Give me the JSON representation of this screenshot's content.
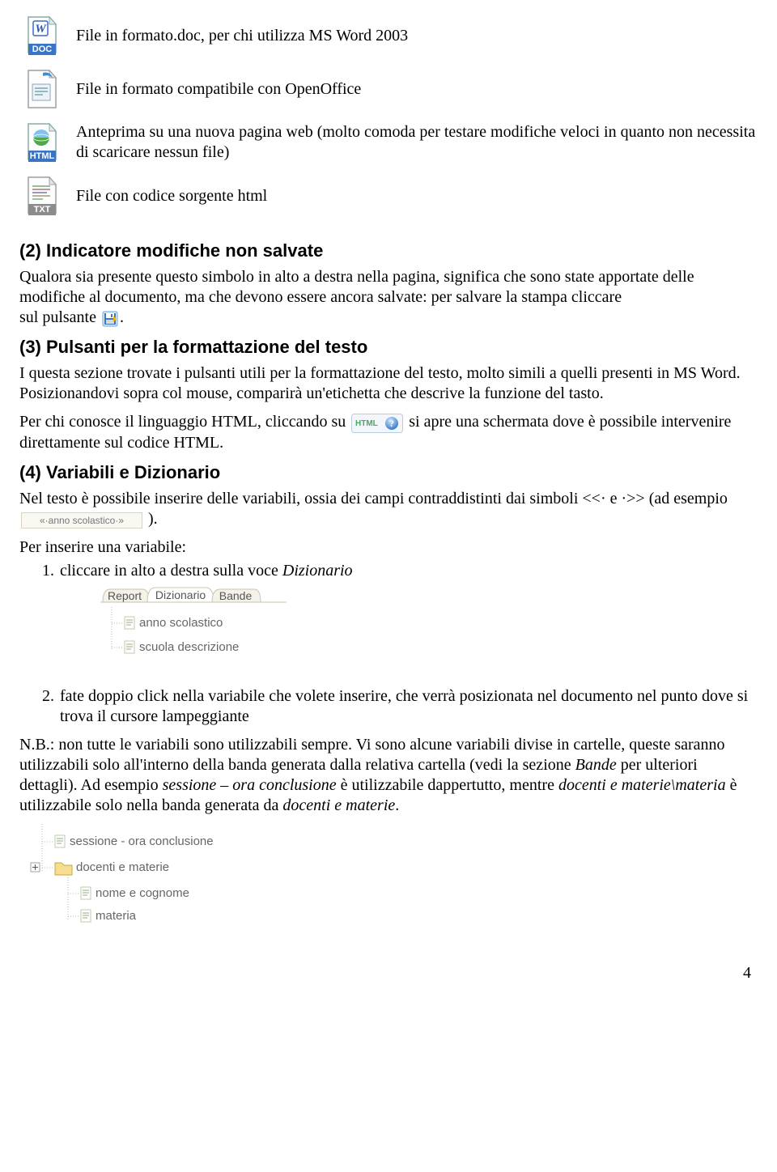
{
  "iconList": [
    {
      "type": "doc",
      "desc": "File in formato.doc, per chi utilizza MS Word 2003"
    },
    {
      "type": "oo",
      "desc": "File in formato compatibile con OpenOffice"
    },
    {
      "type": "html",
      "desc": "Anteprima su una nuova pagina web (molto comoda per testare modifiche veloci in quanto non necessita di scaricare nessun file)"
    },
    {
      "type": "txt",
      "desc": "File con codice sorgente html"
    }
  ],
  "sec2": {
    "title": "(2) Indicatore modifiche non salvate",
    "para_a": "Qualora sia presente questo simbolo in alto a destra nella pagina, significa che sono state apportate delle modifiche al documento, ma che devono essere ancora salvate: per salvare la stampa cliccare",
    "para_b": "sul pulsante",
    "para_c": "."
  },
  "sec3": {
    "title": "(3) Pulsanti per la formattazione del testo",
    "p1": "I questa sezione trovate i pulsanti utili per la formattazione del testo, molto simili a quelli presenti in MS Word. Posizionandovi sopra col mouse, comparirà un'etichetta che descrive la funzione del tasto.",
    "p2a": "Per chi conosce il linguaggio HTML, cliccando su",
    "p2b": "si apre una schermata dove è possibile intervenire direttamente sul codice HTML."
  },
  "sec4": {
    "title": "(4) Variabili e Dizionario",
    "p1a": "Nel testo è possibile inserire delle variabili, ossia dei campi contraddistinti dai simboli <<· e ·>> (ad esempio",
    "p1b": ").",
    "p2": "Per inserire una variabile:",
    "li1a": "cliccare in alto a destra sulla voce ",
    "li1b": "Dizionario",
    "li2": "fate doppio click nella variabile che volete inserire, che verrà posizionata nel documento nel punto dove si trova il cursore lampeggiante",
    "nb_label": "N.B.:  ",
    "nb_1": "non tutte le variabili sono utilizzabili sempre. Vi sono alcune variabili divise in cartelle, queste saranno utilizzabili solo all'interno della banda generata dalla relativa cartella (vedi la sezione ",
    "nb_2": "Bande",
    "nb_3": " per ulteriori dettagli).  Ad esempio ",
    "nb_4": "sessione – ora conclusione",
    "nb_5": " è utilizzabile dappertutto, mentre ",
    "nb_6": "docenti e materie\\materia",
    "nb_7": " è utilizzabile solo nella banda generata da ",
    "nb_8": "docenti e materie",
    "nb_9": "."
  },
  "inlineHtmlLabel": "HTML",
  "varBadge": "«·anno scolastico·»",
  "tabs": {
    "report": "Report",
    "dizionario": "Dizionario",
    "bande": "Bande"
  },
  "tree1": {
    "item1": "anno scolastico",
    "item2": "scuola descrizione"
  },
  "tree2": {
    "item1": "sessione - ora conclusione",
    "folder": "docenti e materie",
    "child1": "nome e cognome",
    "child2": "materia"
  },
  "pageNumber": "4"
}
